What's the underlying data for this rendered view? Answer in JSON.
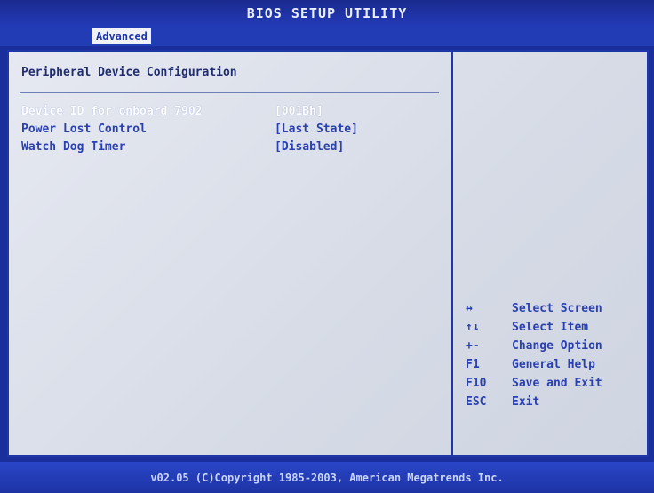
{
  "app": {
    "title": "BIOS SETUP UTILITY"
  },
  "tabs": [
    {
      "label": "Advanced"
    }
  ],
  "panel": {
    "section_title": "Peripheral Device Configuration",
    "settings": [
      {
        "label": "Device ID for onboard 7902",
        "value": "[001Bh]"
      },
      {
        "label": "Power Lost Control",
        "value": "[Last State]"
      },
      {
        "label": "Watch Dog Timer",
        "value": "[Disabled]"
      }
    ]
  },
  "help": [
    {
      "key": "↔",
      "desc": "Select Screen"
    },
    {
      "key": "↑↓",
      "desc": "Select Item"
    },
    {
      "key": "+-",
      "desc": "Change Option"
    },
    {
      "key": "F1",
      "desc": "General Help"
    },
    {
      "key": "F10",
      "desc": "Save and Exit"
    },
    {
      "key": "ESC",
      "desc": "Exit"
    }
  ],
  "footer": {
    "copyright": "v02.05 (C)Copyright 1985-2003, American Megatrends Inc."
  }
}
